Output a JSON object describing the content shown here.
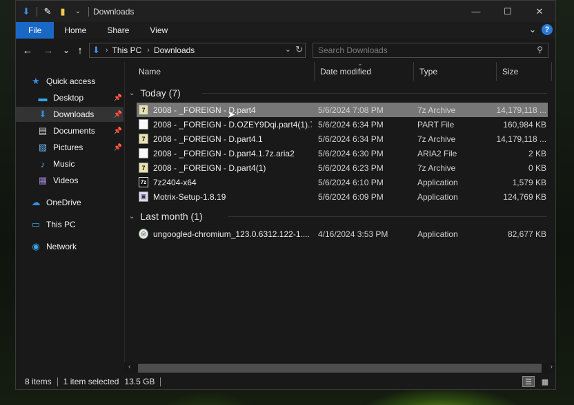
{
  "window": {
    "title": "Downloads",
    "controls": {
      "minimize": "—",
      "maximize": "☐",
      "close": "✕"
    }
  },
  "ribbon": {
    "tabs": [
      "File",
      "Home",
      "Share",
      "View"
    ],
    "help": "?"
  },
  "nav": {
    "back": "←",
    "forward": "→",
    "recent": "⌄",
    "up": "↑",
    "breadcrumb": [
      "This PC",
      "Downloads"
    ],
    "search_placeholder": "Search Downloads"
  },
  "sidebar": {
    "items": [
      {
        "label": "Quick access",
        "icon": "star-icon",
        "glyph": "★",
        "color": "#3b8fe0",
        "pinned": false
      },
      {
        "label": "Desktop",
        "icon": "desktop-folder-icon",
        "glyph": "▬",
        "color": "#3aa3ea",
        "pinned": true
      },
      {
        "label": "Downloads",
        "icon": "download-folder-icon",
        "glyph": "⬇",
        "color": "#2f8de0",
        "pinned": true
      },
      {
        "label": "Documents",
        "icon": "documents-folder-icon",
        "glyph": "▤",
        "color": "#cfcfcf",
        "pinned": true
      },
      {
        "label": "Pictures",
        "icon": "pictures-folder-icon",
        "glyph": "▧",
        "color": "#6fb0e8",
        "pinned": true
      },
      {
        "label": "Music",
        "icon": "music-folder-icon",
        "glyph": "♪",
        "color": "#4aa0e8",
        "pinned": false
      },
      {
        "label": "Videos",
        "icon": "videos-folder-icon",
        "glyph": "▦",
        "color": "#9a7fd0",
        "pinned": false
      },
      {
        "label": "OneDrive",
        "icon": "onedrive-cloud-icon",
        "glyph": "☁",
        "color": "#3b8fe0",
        "pinned": false
      },
      {
        "label": "This PC",
        "icon": "computer-icon",
        "glyph": "▭",
        "color": "#3aa3ea",
        "pinned": false
      },
      {
        "label": "Network",
        "icon": "network-icon",
        "glyph": "◉",
        "color": "#3aa3ea",
        "pinned": false
      }
    ]
  },
  "columns": {
    "name": "Name",
    "date": "Date modified",
    "type": "Type",
    "size": "Size"
  },
  "groups": [
    {
      "label": "Today (7)",
      "files": [
        {
          "name": "2008 - _FOREIGN - D.part4",
          "date": "5/6/2024 7:08 PM",
          "type": "7z Archive",
          "size": "14,179,118 ...",
          "icon": "7z-archive-icon",
          "selected": true
        },
        {
          "name": "2008 - _FOREIGN - D.OZEY9Dqi.part4(1).7...",
          "date": "5/6/2024 6:34 PM",
          "type": "PART File",
          "size": "160,984 KB",
          "icon": "blank-file-icon",
          "selected": false
        },
        {
          "name": "2008 - _FOREIGN - D.part4.1",
          "date": "5/6/2024 6:34 PM",
          "type": "7z Archive",
          "size": "14,179,118 ...",
          "icon": "7z-archive-icon",
          "selected": false
        },
        {
          "name": "2008 - _FOREIGN - D.part4.1.7z.aria2",
          "date": "5/6/2024 6:30 PM",
          "type": "ARIA2 File",
          "size": "2 KB",
          "icon": "blank-file-icon",
          "selected": false
        },
        {
          "name": "2008 - _FOREIGN - D.part4(1)",
          "date": "5/6/2024 6:23 PM",
          "type": "7z Archive",
          "size": "0 KB",
          "icon": "7z-archive-icon",
          "selected": false
        },
        {
          "name": "7z2404-x64",
          "date": "5/6/2024 6:10 PM",
          "type": "Application",
          "size": "1,579 KB",
          "icon": "7zip-installer-icon",
          "selected": false
        },
        {
          "name": "Motrix-Setup-1.8.19",
          "date": "5/6/2024 6:09 PM",
          "type": "Application",
          "size": "124,769 KB",
          "icon": "motrix-installer-icon",
          "selected": false
        }
      ]
    },
    {
      "label": "Last month (1)",
      "files": [
        {
          "name": "ungoogled-chromium_123.0.6312.122-1....",
          "date": "4/16/2024 3:53 PM",
          "type": "Application",
          "size": "82,677 KB",
          "icon": "chromium-installer-icon",
          "selected": false
        }
      ]
    }
  ],
  "status": {
    "items": "8 items",
    "selected": "1 item selected",
    "size": "13.5 GB"
  }
}
